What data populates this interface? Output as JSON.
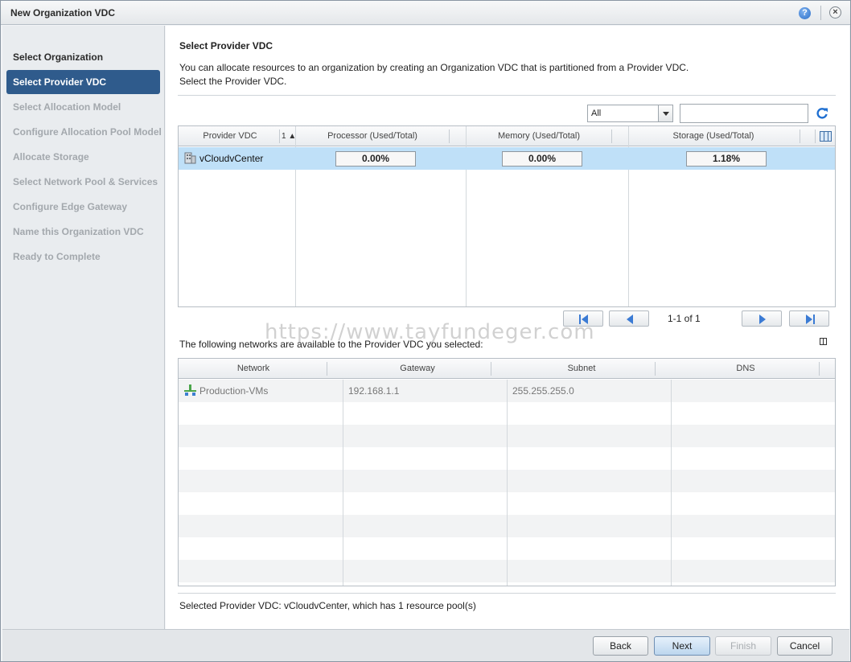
{
  "window": {
    "title": "New Organization VDC"
  },
  "nav": {
    "items": [
      {
        "label": "Select Organization",
        "state": "done"
      },
      {
        "label": "Select Provider VDC",
        "state": "active"
      },
      {
        "label": "Select Allocation Model",
        "state": "pending"
      },
      {
        "label": "Configure Allocation Pool Model",
        "state": "pending"
      },
      {
        "label": "Allocate Storage",
        "state": "pending"
      },
      {
        "label": "Select Network Pool & Services",
        "state": "pending"
      },
      {
        "label": "Configure Edge Gateway",
        "state": "pending"
      },
      {
        "label": "Name this Organization VDC",
        "state": "pending"
      },
      {
        "label": "Ready to Complete",
        "state": "pending"
      }
    ]
  },
  "main": {
    "title": "Select Provider VDC",
    "desc_line1": "You can allocate resources to an organization by creating an Organization VDC that is partitioned from a Provider VDC.",
    "desc_line2": "Select the Provider VDC.",
    "filter": {
      "selected": "All"
    },
    "search": {
      "value": ""
    },
    "provider_grid": {
      "columns": [
        "Provider VDC",
        "Processor (Used/Total)",
        "Memory (Used/Total)",
        "Storage (Used/Total)"
      ],
      "sort_indicator": "1 ▲",
      "rows": [
        {
          "name": "vCloudvCenter",
          "processor": "0.00%",
          "memory": "0.00%",
          "storage": "1.18%"
        }
      ]
    },
    "pager": {
      "text": "1-1 of 1"
    },
    "watermark": "https://www.tayfundeger.com",
    "networks_desc": "The following networks are available to the Provider VDC you selected:",
    "network_grid": {
      "columns": [
        "Network",
        "Gateway",
        "Subnet",
        "DNS"
      ],
      "rows": [
        {
          "network": "Production-VMs",
          "gateway": "192.168.1.1",
          "subnet": "255.255.255.0",
          "dns": ""
        }
      ]
    },
    "status": "Selected Provider VDC: vCloudvCenter, which has 1 resource pool(s)"
  },
  "footer": {
    "back": "Back",
    "next": "Next",
    "finish": "Finish",
    "cancel": "Cancel"
  },
  "colors": {
    "accent": "#2f5b8c",
    "selection": "#bfe0f8"
  }
}
